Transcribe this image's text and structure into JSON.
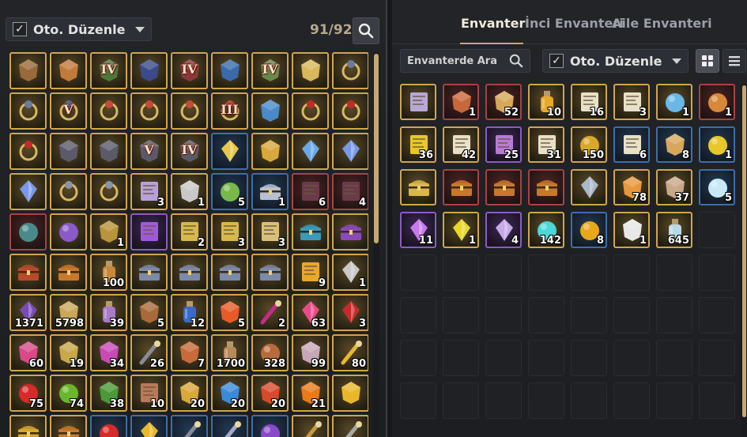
{
  "left": {
    "autosort_label": "Oto. Düzenle",
    "autosort_checked": "✓",
    "slot_count": "91/92",
    "search_icon": "search-icon",
    "items": [
      {
        "icon": "helmet-icon",
        "rarity": "gold",
        "color": "#9a6a3a"
      },
      {
        "icon": "armor-icon",
        "rarity": "gold",
        "color": "#c07a3a"
      },
      {
        "icon": "wing-armor-icon",
        "rarity": "gold",
        "tier": "IV",
        "color": "#4a7a3a"
      },
      {
        "icon": "gauntlet-icon",
        "rarity": "gold",
        "color": "#3a4a8a"
      },
      {
        "icon": "gloves-icon",
        "rarity": "gold",
        "tier": "IV",
        "color": "#8a3a3a"
      },
      {
        "icon": "boots-icon",
        "rarity": "gold",
        "color": "#3a6aaa"
      },
      {
        "icon": "greaves-icon",
        "rarity": "gold",
        "tier": "IV",
        "color": "#6a8a4a"
      },
      {
        "icon": "circlet-icon",
        "rarity": "gold",
        "color": "#d8b85a"
      },
      {
        "icon": "necklace-icon",
        "rarity": "gold",
        "color": "#6a7aa0"
      },
      {
        "icon": "necklace-icon",
        "rarity": "gold",
        "color": "#6a7aa0"
      },
      {
        "icon": "necklace-icon",
        "rarity": "gold",
        "tier": "V",
        "color": "#5a6a90"
      },
      {
        "icon": "ring-icon",
        "rarity": "gold",
        "color": "#c44a3a"
      },
      {
        "icon": "ring-icon",
        "rarity": "gold",
        "color": "#c44a3a"
      },
      {
        "icon": "ring-icon",
        "rarity": "gold",
        "color": "#c44a3a"
      },
      {
        "icon": "ring-icon",
        "rarity": "gold",
        "tier": "III",
        "color": "#c44a3a"
      },
      {
        "icon": "star-medallion-icon",
        "rarity": "gold",
        "color": "#4a8ac8"
      },
      {
        "icon": "earring-icon",
        "rarity": "gold",
        "color": "#c42a2a"
      },
      {
        "icon": "earring-icon",
        "rarity": "gold",
        "color": "#c42a2a"
      },
      {
        "icon": "earring-icon",
        "rarity": "gold",
        "color": "#c42a2a"
      },
      {
        "icon": "bracer-icon",
        "rarity": "gold",
        "color": "#5a5a6a"
      },
      {
        "icon": "bracer-icon",
        "rarity": "gold",
        "color": "#5a5a6a"
      },
      {
        "icon": "bracer-icon",
        "rarity": "gold",
        "tier": "V",
        "color": "#5a5a6a"
      },
      {
        "icon": "bracer-icon",
        "rarity": "gold",
        "tier": "IV",
        "color": "#5a5a6a"
      },
      {
        "icon": "feather-icon",
        "rarity": "blue",
        "color": "#e8c84a"
      },
      {
        "icon": "lotus-emblem-icon",
        "rarity": "gold",
        "color": "#d8a83a"
      },
      {
        "icon": "crystal-icon",
        "rarity": "gold",
        "color": "#6aa8e8"
      },
      {
        "icon": "crystal-icon",
        "rarity": "gold",
        "color": "#7a98e8"
      },
      {
        "icon": "crystal-icon",
        "rarity": "gold",
        "color": "#7a98e8"
      },
      {
        "icon": "silver-necklace-icon",
        "rarity": "gold",
        "color": "#8a94a8"
      },
      {
        "icon": "silver-necklace-icon",
        "rarity": "gold",
        "color": "#8a94a8"
      },
      {
        "icon": "scroll-pedestal-icon",
        "rarity": "gold",
        "qty": "3",
        "color": "#b8a0d8"
      },
      {
        "icon": "silver-tree-icon",
        "rarity": "gold",
        "qty": "1",
        "color": "#c8c8c8"
      },
      {
        "icon": "potion-plant-icon",
        "rarity": "blue",
        "qty": "5",
        "color": "#7ab84a"
      },
      {
        "icon": "silver-chest-icon",
        "rarity": "blue",
        "qty": "1",
        "color": "#b8c0d0"
      },
      {
        "icon": "tome-icon",
        "rarity": "red",
        "qty": "6",
        "color": "#6a3a4a"
      },
      {
        "icon": "tome-icon",
        "rarity": "red",
        "qty": "4",
        "color": "#6a3a4a"
      },
      {
        "icon": "stone-egg-icon",
        "rarity": "red",
        "color": "#4a8a8a"
      },
      {
        "icon": "magic-orb-icon",
        "rarity": "gold",
        "color": "#8a5ac8"
      },
      {
        "icon": "compass-icon",
        "rarity": "gold",
        "qty": "1",
        "color": "#b8943a"
      },
      {
        "icon": "magic-scroll-icon",
        "rarity": "purple",
        "color": "#a05ad8"
      },
      {
        "icon": "card-scroll-icon",
        "rarity": "gold",
        "qty": "2",
        "color": "#d8b84a"
      },
      {
        "icon": "card-scroll-icon",
        "rarity": "gold",
        "qty": "3",
        "color": "#d8b84a"
      },
      {
        "icon": "treasure-map-icon",
        "rarity": "gold",
        "qty": "3",
        "color": "#d8c07a"
      },
      {
        "icon": "blue-chest-icon",
        "rarity": "gold",
        "color": "#3a9ab8"
      },
      {
        "icon": "purple-chest-icon",
        "rarity": "gold",
        "color": "#8a4ab8"
      },
      {
        "icon": "red-chest-icon",
        "rarity": "gold",
        "color": "#b84a2a"
      },
      {
        "icon": "treasure-chest-icon",
        "rarity": "gold",
        "color": "#c8782a"
      },
      {
        "icon": "bottle-icon",
        "rarity": "gold",
        "qty": "100",
        "color": "#c8883a"
      },
      {
        "icon": "steel-chest-icon",
        "rarity": "gold",
        "color": "#7a8aa8"
      },
      {
        "icon": "steel-chest-icon",
        "rarity": "gold",
        "color": "#7a8aa8"
      },
      {
        "icon": "steel-chest-icon",
        "rarity": "gold",
        "color": "#7a8aa8"
      },
      {
        "icon": "steel-chest-icon",
        "rarity": "gold",
        "color": "#7a8aa8"
      },
      {
        "icon": "gold-ticket-icon",
        "rarity": "gold",
        "qty": "9",
        "color": "#e8a82a"
      },
      {
        "icon": "feather-quill-icon",
        "rarity": "gold",
        "qty": "1",
        "color": "#c8c8c8"
      },
      {
        "icon": "purple-gem-icon",
        "rarity": "gold",
        "qty": "1371",
        "color": "#7a4ab8"
      },
      {
        "icon": "potato-icon",
        "rarity": "gold",
        "qty": "5798",
        "color": "#c8a85a"
      },
      {
        "icon": "flask-icon",
        "rarity": "gold",
        "qty": "39",
        "color": "#a87ac8"
      },
      {
        "icon": "produce-basket-icon",
        "rarity": "gold",
        "qty": "5",
        "color": "#a86a3a"
      },
      {
        "icon": "blue-can-icon",
        "rarity": "gold",
        "qty": "12",
        "color": "#3a6ac8"
      },
      {
        "icon": "fire-burst-icon",
        "rarity": "gold",
        "qty": "5",
        "color": "#e85a2a"
      },
      {
        "icon": "claw-slash-icon",
        "rarity": "gold",
        "qty": "2",
        "color": "#c82a8a"
      },
      {
        "icon": "pink-crystal-icon",
        "rarity": "gold",
        "qty": "63",
        "color": "#e84a8a"
      },
      {
        "icon": "red-shard-icon",
        "rarity": "gold",
        "qty": "3",
        "color": "#c82a2a"
      },
      {
        "icon": "fire-rune-icon",
        "rarity": "gold",
        "qty": "60",
        "color": "#d84a8a"
      },
      {
        "icon": "emblem-icon",
        "rarity": "gold",
        "qty": "19",
        "color": "#c8a84a"
      },
      {
        "icon": "vortex-icon",
        "rarity": "gold",
        "qty": "34",
        "color": "#c84ab8"
      },
      {
        "icon": "claw-icon",
        "rarity": "gold",
        "qty": "26",
        "color": "#8a8a9a"
      },
      {
        "icon": "ore-icon",
        "rarity": "gold",
        "qty": "7",
        "color": "#c86a3a"
      },
      {
        "icon": "jar-icon",
        "rarity": "gold",
        "qty": "1700",
        "color": "#b88a5a"
      },
      {
        "icon": "copper-coin-icon",
        "rarity": "gold",
        "qty": "328",
        "color": "#b86a3a"
      },
      {
        "icon": "smoke-icon",
        "rarity": "gold",
        "qty": "99",
        "color": "#c8a8b8"
      },
      {
        "icon": "horn-icon",
        "rarity": "gold",
        "qty": "80",
        "color": "#e8b82a"
      },
      {
        "icon": "red-orb-icon",
        "rarity": "gold",
        "qty": "75",
        "color": "#d82a2a"
      },
      {
        "icon": "green-sphere-icon",
        "rarity": "gold",
        "qty": "74",
        "color": "#6ab82a"
      },
      {
        "icon": "herb-icon",
        "rarity": "gold",
        "qty": "38",
        "color": "#4a9a3a"
      },
      {
        "icon": "scroll-bundle-icon",
        "rarity": "gold",
        "qty": "10",
        "color": "#b87a5a"
      },
      {
        "icon": "gold-compass-icon",
        "rarity": "gold",
        "qty": "20",
        "color": "#d8a83a"
      },
      {
        "icon": "blue-compass-icon",
        "rarity": "gold",
        "qty": "20",
        "color": "#3a8ad8"
      },
      {
        "icon": "red-compass-icon",
        "rarity": "gold",
        "qty": "20",
        "color": "#d84a2a"
      },
      {
        "icon": "fire-compass-icon",
        "rarity": "gold",
        "qty": "21",
        "color": "#e87a1a"
      },
      {
        "icon": "gold-bar-icon",
        "rarity": "gold",
        "color": "#e8b82a"
      },
      {
        "icon": "gold-chest-icon",
        "rarity": "gold",
        "color": "#d8a82a"
      },
      {
        "icon": "chest-icon",
        "rarity": "gold",
        "color": "#c8782a"
      },
      {
        "icon": "red-fruit-icon",
        "rarity": "blue",
        "color": "#d82a2a"
      },
      {
        "icon": "gold-crystal-icon",
        "rarity": "blue",
        "color": "#e8b82a"
      },
      {
        "icon": "hammer-icon",
        "rarity": "blue",
        "color": "#8a8a9a"
      },
      {
        "icon": "claw-icon",
        "rarity": "blue",
        "color": "#a8a8c8"
      },
      {
        "icon": "purple-orb-icon",
        "rarity": "blue",
        "color": "#8a4ac8"
      },
      {
        "icon": "staff-icon",
        "rarity": "gold",
        "color": "#c89a3a"
      },
      {
        "icon": "staff-icon",
        "rarity": "gold",
        "color": "#a8a8a8"
      }
    ]
  },
  "right": {
    "tabs": [
      "Envanter",
      "İnci Envanteri",
      "Aile Envanteri"
    ],
    "search_placeholder": "Envanterde Ara",
    "search_icon": "search-icon",
    "autosort_label": "Oto. Düzenle",
    "autosort_checked": "✓",
    "items": [
      {
        "icon": "book-icon",
        "rarity": "gold",
        "color": "#b8a8d8"
      },
      {
        "icon": "meal-plate-icon",
        "rarity": "red",
        "qty": "1",
        "color": "#c8683a"
      },
      {
        "icon": "food-platter-icon",
        "rarity": "red",
        "qty": "52",
        "color": "#d8a85a"
      },
      {
        "icon": "cocktail-icon",
        "rarity": "gold",
        "qty": "10",
        "color": "#e8a82a"
      },
      {
        "icon": "map-scroll-icon",
        "rarity": "gold",
        "qty": "16",
        "color": "#e8e0c8"
      },
      {
        "icon": "map-scroll-icon",
        "rarity": "gold",
        "qty": "3",
        "color": "#e8e0c8"
      },
      {
        "icon": "blue-potion-icon",
        "rarity": "gold",
        "qty": "1",
        "color": "#6ab8e8"
      },
      {
        "icon": "amber-potion-icon",
        "rarity": "red",
        "qty": "1",
        "color": "#d8883a"
      },
      {
        "icon": "gold-ticket-icon",
        "rarity": "gold",
        "qty": "36",
        "color": "#e8c82a"
      },
      {
        "icon": "map-scroll-icon",
        "rarity": "gold",
        "qty": "42",
        "color": "#e8e0c8"
      },
      {
        "icon": "purple-map-icon",
        "rarity": "purple",
        "qty": "25",
        "color": "#b87ad8"
      },
      {
        "icon": "map-scroll-icon",
        "rarity": "gold",
        "qty": "31",
        "color": "#e8e0c8"
      },
      {
        "icon": "gold-coin-icon",
        "rarity": "gold",
        "qty": "150",
        "color": "#d8a82a"
      },
      {
        "icon": "map-scroll-icon",
        "rarity": "blue",
        "qty": "6",
        "color": "#e8e0c8"
      },
      {
        "icon": "gold-ore-icon",
        "rarity": "blue",
        "qty": "8",
        "color": "#d8a85a"
      },
      {
        "icon": "gold-potion-icon",
        "rarity": "blue",
        "qty": "1",
        "color": "#e8c82a"
      },
      {
        "icon": "gold-brick-chest-icon",
        "rarity": "gold",
        "color": "#d8b84a"
      },
      {
        "icon": "treasure-chest-icon",
        "rarity": "red",
        "color": "#c8782a"
      },
      {
        "icon": "treasure-chest-icon",
        "rarity": "red",
        "color": "#c8782a"
      },
      {
        "icon": "treasure-chest-icon",
        "rarity": "red",
        "color": "#c8782a"
      },
      {
        "icon": "crystal-cluster-icon",
        "rarity": "gold",
        "color": "#a8b8c8"
      },
      {
        "icon": "amber-chunk-icon",
        "rarity": "gold",
        "qty": "78",
        "color": "#e8983a"
      },
      {
        "icon": "bowl-icon",
        "rarity": "gold",
        "qty": "37",
        "color": "#c8a88a"
      },
      {
        "icon": "silver-orb-icon",
        "rarity": "blue",
        "qty": "5",
        "color": "#c8e8f8"
      },
      {
        "icon": "purple-crystal-icon",
        "rarity": "purple",
        "qty": "11",
        "color": "#c87ae8"
      },
      {
        "icon": "yellow-gem-icon",
        "rarity": "gold",
        "qty": "1",
        "color": "#e8d82a"
      },
      {
        "icon": "prism-gem-icon",
        "rarity": "purple",
        "qty": "4",
        "color": "#c8a8e8"
      },
      {
        "icon": "cyan-orb-icon",
        "rarity": "gold",
        "qty": "142",
        "color": "#4ad8d8"
      },
      {
        "icon": "golden-egg-icon",
        "rarity": "blue",
        "qty": "8",
        "color": "#e8a81a"
      },
      {
        "icon": "white-cube-icon",
        "rarity": "gold",
        "qty": "1",
        "color": "#e8e8e8"
      },
      {
        "icon": "vial-icon",
        "rarity": "gold",
        "qty": "645",
        "color": "#b8d8e8"
      },
      {
        "icon": "empty-slot",
        "rarity": "empty"
      }
    ],
    "empty_slots": 32
  }
}
